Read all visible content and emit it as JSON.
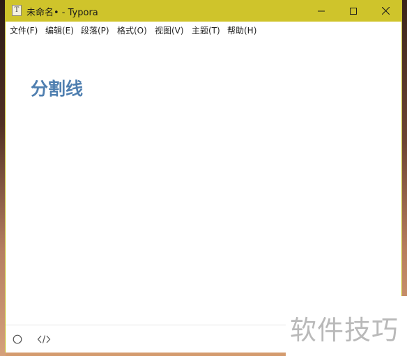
{
  "window": {
    "title": "未命名• - Typora",
    "app_icon_glyph": "T",
    "titlebar_color": "#cfc42b"
  },
  "menu": {
    "items": [
      {
        "label": "文件(F)"
      },
      {
        "label": "编辑(E)"
      },
      {
        "label": "段落(P)"
      },
      {
        "label": "格式(O)"
      },
      {
        "label": "视图(V)"
      },
      {
        "label": "主题(T)"
      },
      {
        "label": "帮助(H)"
      }
    ]
  },
  "editor": {
    "heading": "分割线",
    "heading_color": "#4f7fb0"
  },
  "statusbar": {
    "outline_icon": "circle-icon",
    "source_icon": "code-icon"
  },
  "watermark": {
    "text": "软件技巧"
  }
}
